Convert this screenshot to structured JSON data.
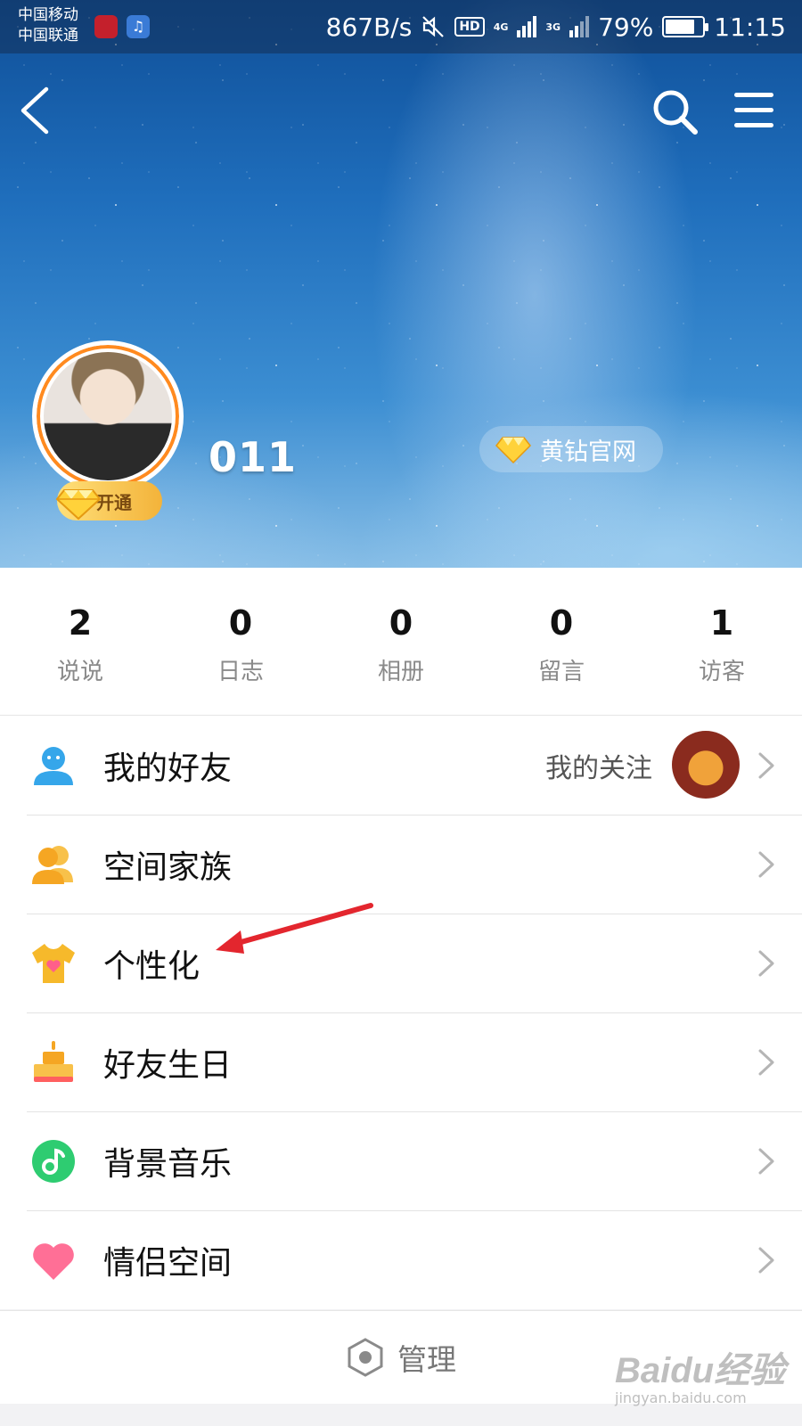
{
  "status_bar": {
    "carrier_1": "中国移动",
    "carrier_2": "中国联通",
    "speed": "867B/s",
    "hd": "HD",
    "net_1": "4G",
    "net_2": "3G",
    "battery": "79%",
    "battery_level": 0.79,
    "time": "11:15"
  },
  "profile": {
    "username": "011",
    "vip_label": "开通",
    "official_label": "黄钻官网"
  },
  "stats": [
    {
      "value": "2",
      "label": "说说"
    },
    {
      "value": "0",
      "label": "日志"
    },
    {
      "value": "0",
      "label": "相册"
    },
    {
      "value": "0",
      "label": "留言"
    },
    {
      "value": "1",
      "label": "访客"
    }
  ],
  "menu": [
    {
      "label": "我的好友",
      "sub": "我的关注",
      "icon": "friend-icon"
    },
    {
      "label": "空间家族",
      "icon": "family-icon"
    },
    {
      "label": "个性化",
      "icon": "tshirt-icon"
    },
    {
      "label": "好友生日",
      "icon": "cake-icon"
    },
    {
      "label": "背景音乐",
      "icon": "music-icon"
    },
    {
      "label": "情侣空间",
      "icon": "heart-icon"
    }
  ],
  "manage": {
    "label": "管理",
    "icon": "hexagon-icon"
  },
  "watermark": {
    "brand": "Baidu经验",
    "url": "jingyan.baidu.com"
  },
  "colors": {
    "accent_red_arrow": "#e3262e",
    "badge_gold": "#f3b33a",
    "friend_icon": "#35a6ea",
    "family_icon": "#f5a623",
    "music_icon": "#2ecc71",
    "heart_icon": "#ff5f8a"
  }
}
